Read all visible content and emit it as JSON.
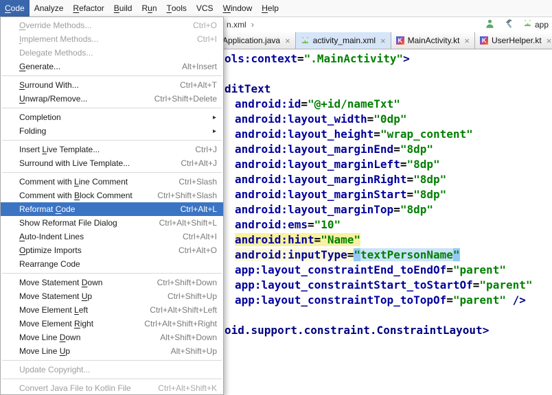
{
  "menubar": {
    "items": [
      {
        "label": "Code",
        "mnemonic": 0,
        "selected": true
      },
      {
        "label": "Analyze",
        "mnemonic": null
      },
      {
        "label": "Refactor",
        "mnemonic": 0
      },
      {
        "label": "Build",
        "mnemonic": 0
      },
      {
        "label": "Run",
        "mnemonic": 1
      },
      {
        "label": "Tools",
        "mnemonic": 0
      },
      {
        "label": "VCS",
        "mnemonic": null
      },
      {
        "label": "Window",
        "mnemonic": 0
      },
      {
        "label": "Help",
        "mnemonic": 0
      }
    ]
  },
  "code_menu": {
    "items": [
      {
        "label": "Override Methods...",
        "shortcut": "Ctrl+O",
        "enabled": false,
        "mnemonic": 0
      },
      {
        "label": "Implement Methods...",
        "shortcut": "Ctrl+I",
        "enabled": false,
        "mnemonic": 0
      },
      {
        "label": "Delegate Methods...",
        "enabled": false,
        "mnemonic": null
      },
      {
        "label": "Generate...",
        "shortcut": "Alt+Insert",
        "mnemonic": 0
      },
      {
        "separator": true
      },
      {
        "label": "Surround With...",
        "shortcut": "Ctrl+Alt+T",
        "mnemonic": 0
      },
      {
        "label": "Unwrap/Remove...",
        "shortcut": "Ctrl+Shift+Delete",
        "mnemonic": 0
      },
      {
        "separator": true
      },
      {
        "label": "Completion",
        "submenu": true,
        "mnemonic": null
      },
      {
        "label": "Folding",
        "submenu": true,
        "mnemonic": null
      },
      {
        "separator": true
      },
      {
        "label": "Insert Live Template...",
        "shortcut": "Ctrl+J",
        "mnemonic": 7
      },
      {
        "label": "Surround with Live Template...",
        "shortcut": "Ctrl+Alt+J",
        "mnemonic": null
      },
      {
        "separator": true
      },
      {
        "label": "Comment with Line Comment",
        "shortcut": "Ctrl+Slash",
        "mnemonic": 13
      },
      {
        "label": "Comment with Block Comment",
        "shortcut": "Ctrl+Shift+Slash",
        "mnemonic": 13
      },
      {
        "label": "Reformat Code",
        "shortcut": "Ctrl+Alt+L",
        "selected": true,
        "mnemonic": 9
      },
      {
        "label": "Show Reformat File Dialog",
        "shortcut": "Ctrl+Alt+Shift+L",
        "mnemonic": null
      },
      {
        "label": "Auto-Indent Lines",
        "shortcut": "Ctrl+Alt+I",
        "mnemonic": 0
      },
      {
        "label": "Optimize Imports",
        "shortcut": "Ctrl+Alt+O",
        "mnemonic": 0
      },
      {
        "label": "Rearrange Code",
        "mnemonic": null
      },
      {
        "separator": true
      },
      {
        "label": "Move Statement Down",
        "shortcut": "Ctrl+Shift+Down",
        "mnemonic": 15
      },
      {
        "label": "Move Statement Up",
        "shortcut": "Ctrl+Shift+Up",
        "mnemonic": 15
      },
      {
        "label": "Move Element Left",
        "shortcut": "Ctrl+Alt+Shift+Left",
        "mnemonic": 13
      },
      {
        "label": "Move Element Right",
        "shortcut": "Ctrl+Alt+Shift+Right",
        "mnemonic": 13
      },
      {
        "label": "Move Line Down",
        "shortcut": "Alt+Shift+Down",
        "mnemonic": 10
      },
      {
        "label": "Move Line Up",
        "shortcut": "Alt+Shift+Up",
        "mnemonic": 10
      },
      {
        "separator": true
      },
      {
        "label": "Update Copyright...",
        "enabled": false,
        "mnemonic": null
      },
      {
        "separator": true
      },
      {
        "label": "Convert Java File to Kotlin File",
        "shortcut": "Ctrl+Alt+Shift+K",
        "enabled": false,
        "mnemonic": null
      }
    ]
  },
  "navbar": {
    "breadcrumb_file": "n.xml",
    "chevron": "›",
    "run_config": "app"
  },
  "tabs": [
    {
      "label": "Application.java",
      "icon": "java-class",
      "active": false
    },
    {
      "label": "activity_main.xml",
      "icon": "android",
      "active": true
    },
    {
      "label": "MainActivity.kt",
      "icon": "kotlin",
      "active": false
    },
    {
      "label": "UserHelper.kt",
      "icon": "kotlin",
      "active": false
    }
  ],
  "editor": {
    "lines": [
      {
        "indent": 0,
        "hl": null,
        "segs": [
          [
            "ols:context",
            "attr"
          ],
          [
            "=",
            "plain"
          ],
          [
            "\".MainActivity\"",
            "value"
          ],
          [
            ">",
            "tag"
          ]
        ]
      },
      {
        "indent": 0,
        "hl": null,
        "segs": []
      },
      {
        "indent": 0,
        "hl": null,
        "segs": [
          [
            "ditText",
            "tag"
          ]
        ]
      },
      {
        "indent": 1,
        "hl": null,
        "segs": [
          [
            "android:id",
            "attr"
          ],
          [
            "=",
            "plain"
          ],
          [
            "\"@+id/nameTxt\"",
            "value"
          ]
        ]
      },
      {
        "indent": 1,
        "hl": null,
        "segs": [
          [
            "android:layout_width",
            "attr"
          ],
          [
            "=",
            "plain"
          ],
          [
            "\"0dp\"",
            "value"
          ]
        ]
      },
      {
        "indent": 1,
        "hl": null,
        "segs": [
          [
            "android:layout_height",
            "attr"
          ],
          [
            "=",
            "plain"
          ],
          [
            "\"wrap_content\"",
            "value"
          ]
        ]
      },
      {
        "indent": 1,
        "hl": null,
        "segs": [
          [
            "android:layout_marginEnd",
            "attr"
          ],
          [
            "=",
            "plain"
          ],
          [
            "\"8dp\"",
            "value"
          ]
        ]
      },
      {
        "indent": 1,
        "hl": null,
        "segs": [
          [
            "android:layout_marginLeft",
            "attr"
          ],
          [
            "=",
            "plain"
          ],
          [
            "\"8dp\"",
            "value"
          ]
        ]
      },
      {
        "indent": 1,
        "hl": null,
        "segs": [
          [
            "android:layout_marginRight",
            "attr"
          ],
          [
            "=",
            "plain"
          ],
          [
            "\"8dp\"",
            "value"
          ]
        ]
      },
      {
        "indent": 1,
        "hl": null,
        "segs": [
          [
            "android:layout_marginStart",
            "attr"
          ],
          [
            "=",
            "plain"
          ],
          [
            "\"8dp\"",
            "value"
          ]
        ]
      },
      {
        "indent": 1,
        "hl": null,
        "segs": [
          [
            "android:layout_marginTop",
            "attr"
          ],
          [
            "=",
            "plain"
          ],
          [
            "\"8dp\"",
            "value"
          ]
        ]
      },
      {
        "indent": 1,
        "hl": null,
        "segs": [
          [
            "android:ems",
            "attr"
          ],
          [
            "=",
            "plain"
          ],
          [
            "\"10\"",
            "value"
          ]
        ]
      },
      {
        "indent": 1,
        "hl": "bright",
        "segs": [
          [
            "android:hint",
            "attr"
          ],
          [
            "=",
            "plain"
          ],
          [
            "\"Name\"",
            "value"
          ]
        ]
      },
      {
        "indent": 1,
        "hl": "pale",
        "segs": [
          [
            "android:inputType",
            "attr"
          ],
          [
            "=",
            "plain"
          ],
          [
            "\"",
            "sel-quote"
          ],
          [
            "textPersonName",
            "sel-value"
          ],
          [
            "\"",
            "sel-quote"
          ]
        ]
      },
      {
        "indent": 1,
        "hl": null,
        "segs": [
          [
            "app:layout_constraintEnd_toEndOf",
            "attr"
          ],
          [
            "=",
            "plain"
          ],
          [
            "\"parent\"",
            "value"
          ]
        ]
      },
      {
        "indent": 1,
        "hl": null,
        "segs": [
          [
            "app:layout_constraintStart_toStartOf",
            "attr"
          ],
          [
            "=",
            "plain"
          ],
          [
            "\"parent\"",
            "value"
          ]
        ]
      },
      {
        "indent": 1,
        "hl": null,
        "segs": [
          [
            "app:layout_constraintTop_toTopOf",
            "attr"
          ],
          [
            "=",
            "plain"
          ],
          [
            "\"parent\"",
            "value"
          ],
          [
            " />",
            "tag"
          ]
        ]
      },
      {
        "indent": 0,
        "hl": null,
        "segs": []
      },
      {
        "indent": 0,
        "hl": null,
        "segs": [
          [
            "oid.support.constraint.ConstraintLayout",
            "tag"
          ],
          [
            ">",
            "tag"
          ]
        ]
      }
    ]
  },
  "colors": {
    "menubar_selected": "#3a66ac",
    "menu_item_selected": "#3c74c4",
    "xml_tag": "#000080",
    "xml_attribute": "#00009c",
    "xml_value": "#008000",
    "hint_highlight": "#f8f1a0",
    "line_highlight": "#fbf9dc",
    "selection_quote": "#94c9f5",
    "selection_value": "#c9e3f9",
    "android_green": "#77c159",
    "toolbar_green": "#59a869"
  }
}
